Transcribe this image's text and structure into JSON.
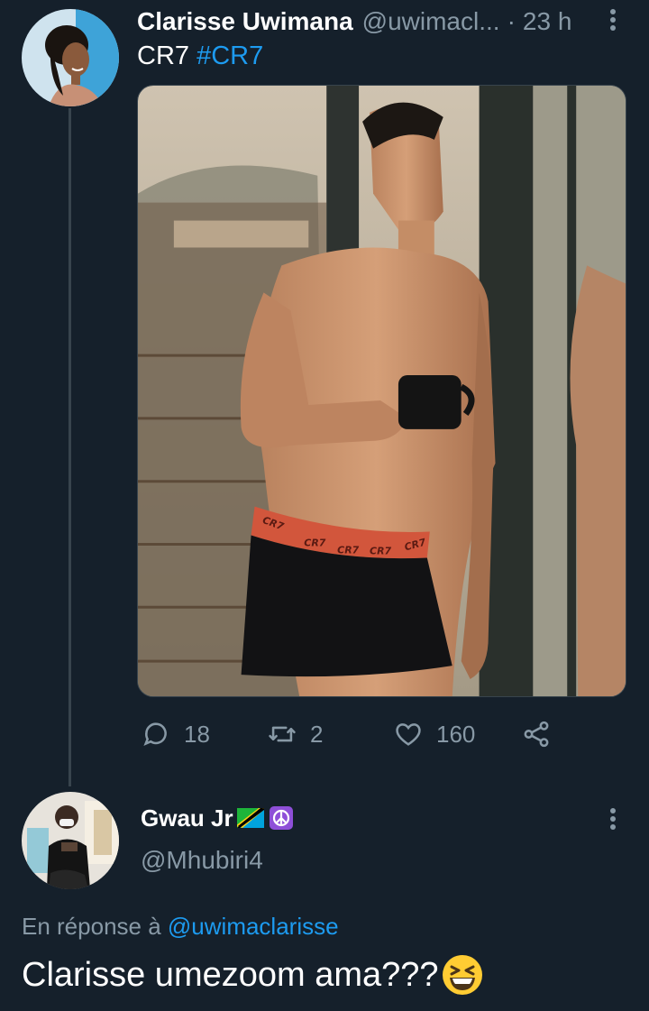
{
  "tweet": {
    "author_name": "Clarisse Uwimana",
    "author_handle": "@uwimacl...",
    "dot": "·",
    "time": "23 h",
    "text": "CR7",
    "hashtag": "#CR7",
    "image_texts": [
      "CR7",
      "CR7",
      "CR7",
      "CR7",
      "CR7"
    ],
    "metrics": {
      "replies": "18",
      "retweets": "2",
      "likes": "160"
    }
  },
  "reply": {
    "author_name": "Gwau Jr",
    "author_handle": "@Mhubiri4",
    "reply_to_prefix": "En réponse à",
    "reply_to_handle": "@uwimaclarisse",
    "text": "Clarisse umezoom ama???"
  },
  "icons": {
    "more": "more-vertical-icon",
    "reply": "comment-icon",
    "retweet": "retweet-icon",
    "like": "heart-icon",
    "share": "share-icon",
    "flag": "tanzania-flag-icon",
    "peace": "peace-symbol-icon",
    "emoji": "grinning-squinting-face-icon"
  },
  "colors": {
    "background": "#15202b",
    "text": "#ffffff",
    "secondary": "#8899a6",
    "link": "#1d9bf0",
    "divider": "#38444d"
  }
}
